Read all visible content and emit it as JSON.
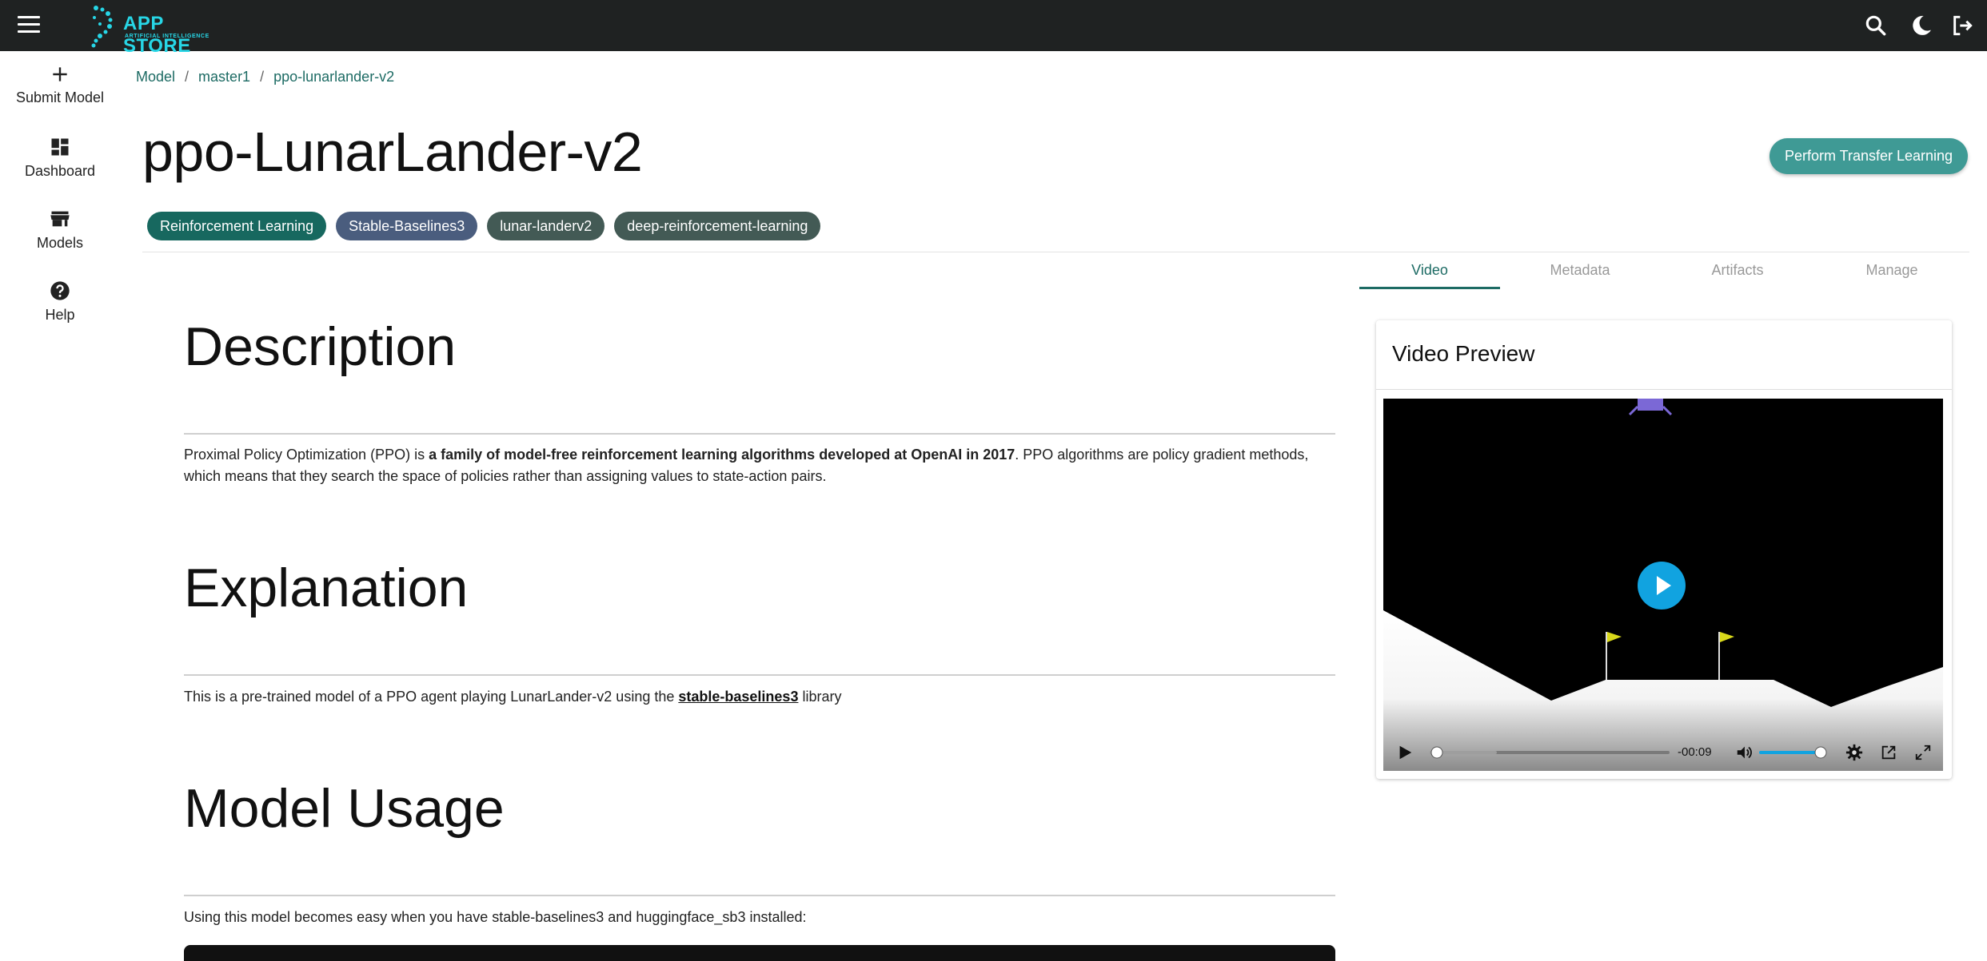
{
  "app": {
    "name": "APP STORE",
    "subtitle": "ARTIFICIAL INTELLIGENCE",
    "brand_color": "#27d6e6",
    "topbar_color": "#1f2222"
  },
  "topbar_icons": [
    "menu-icon",
    "search-icon",
    "moon-icon",
    "logout-icon"
  ],
  "sidebar": {
    "items": [
      {
        "icon": "plus-icon",
        "label": "Submit Model"
      },
      {
        "icon": "dashboard-icon",
        "label": "Dashboard"
      },
      {
        "icon": "store-icon",
        "label": "Models"
      },
      {
        "icon": "help-icon",
        "label": "Help"
      }
    ]
  },
  "breadcrumb": [
    "Model",
    "master1",
    "ppo-lunarlander-v2"
  ],
  "page": {
    "title": "ppo-LunarLander-v2",
    "transfer_button": "Perform Transfer Learning"
  },
  "tags": [
    {
      "label": "Reinforcement Learning",
      "color": "#17685f"
    },
    {
      "label": "Stable-Baselines3",
      "color": "#4a5d7e"
    },
    {
      "label": "lunar-landerv2",
      "color": "#435a55"
    },
    {
      "label": "deep-reinforcement-learning",
      "color": "#435a55"
    }
  ],
  "tabs": [
    {
      "label": "Video",
      "active": true
    },
    {
      "label": "Metadata",
      "active": false
    },
    {
      "label": "Artifacts",
      "active": false
    },
    {
      "label": "Manage",
      "active": false
    }
  ],
  "sections": {
    "description": {
      "heading": "Description",
      "text_start": "Proximal Policy Optimization (PPO) is ",
      "text_bold": "a family of model-free reinforcement learning algorithms developed at OpenAI in 2017",
      "text_end": ". PPO algorithms are policy gradient methods, which means that they search the space of policies rather than assigning values to state-action pairs."
    },
    "explanation": {
      "heading": "Explanation",
      "text_start": "This is a pre-trained model of a PPO agent playing LunarLander-v2 using the ",
      "link": "stable-baselines3",
      "text_end": " library"
    },
    "usage": {
      "heading": "Model Usage",
      "text": "Using this model becomes easy when you have stable-baselines3 and huggingface_sb3 installed:"
    }
  },
  "video_preview": {
    "title": "Video Preview",
    "time_remaining": "-00:09",
    "progress": 0.0,
    "volume": 1.0,
    "accent": "#11a3e0"
  }
}
